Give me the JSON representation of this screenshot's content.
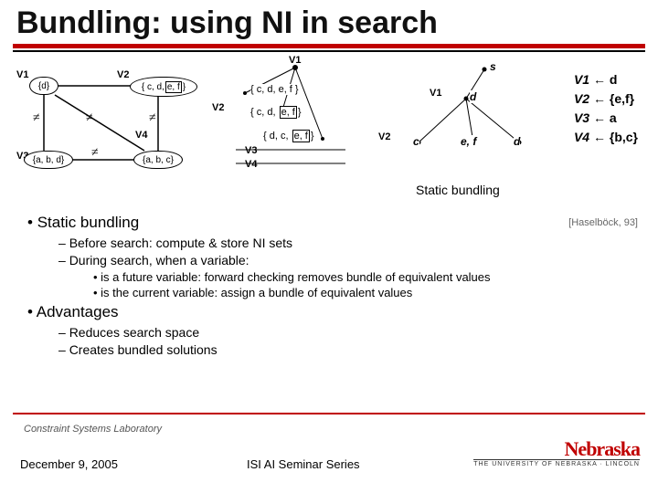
{
  "title": "Bundling: using NI in search",
  "citation": "[Haselböck, 93]",
  "footer": {
    "lab": "Constraint Systems Laboratory",
    "date": "December 9, 2005",
    "series": "ISI AI Seminar Series",
    "logo_name": "Nebraska",
    "logo_sub": "THE UNIVERSITY OF NEBRASKA · LINCOLN"
  },
  "constraint_graph": {
    "nodes": {
      "v1": {
        "label": "V1",
        "domain": "{d}"
      },
      "v2": {
        "label": "V2",
        "domain_prefix": "{ c, d,",
        "domain_boxed": "e, f",
        "domain_suffix": "}"
      },
      "v3": {
        "label": "V3",
        "domain": "{a, b, d}"
      },
      "v4": {
        "label": "V4",
        "domain": "{a, b, c}"
      }
    }
  },
  "search_tree": {
    "root_label": "V1",
    "levels": {
      "v2_label": "V2",
      "v3_label": "V3",
      "v4_label": "V4"
    },
    "nodes": {
      "n1": {
        "prefix": "{ c, d, e, f }"
      },
      "n2": {
        "prefix": "{ c, d, ",
        "box": "e, f",
        "suffix": "}"
      },
      "n3": {
        "prefix": "{ d, c, ",
        "box": "e, f",
        "suffix": "}"
      }
    }
  },
  "dyn_tree": {
    "root": "s",
    "v1_label": "V1",
    "v2_label": "V2",
    "nodes": {
      "d": "d",
      "c": "c",
      "ef": "e, f",
      "dleaf": "d"
    },
    "caption": "Static bundling"
  },
  "assignments": {
    "l1_var": "V1",
    "l1_val": " d",
    "l2_var": "V2",
    "l2_val": " {e,f}",
    "l3_var": "V3",
    "l3_val": " a",
    "l4_var": "V4",
    "l4_val": " {b,c}"
  },
  "bullets": {
    "b1a": "Static bundling",
    "b2a": "Before search: compute & store NI sets",
    "b2b": "During search, when a variable:",
    "b3a": "is a future variable: forward checking removes bundle of equivalent values",
    "b3b": "is the current variable: assign a bundle of equivalent values",
    "b1b": "Advantages",
    "b2c": "Reduces search space",
    "b2d": "Creates bundled solutions"
  }
}
